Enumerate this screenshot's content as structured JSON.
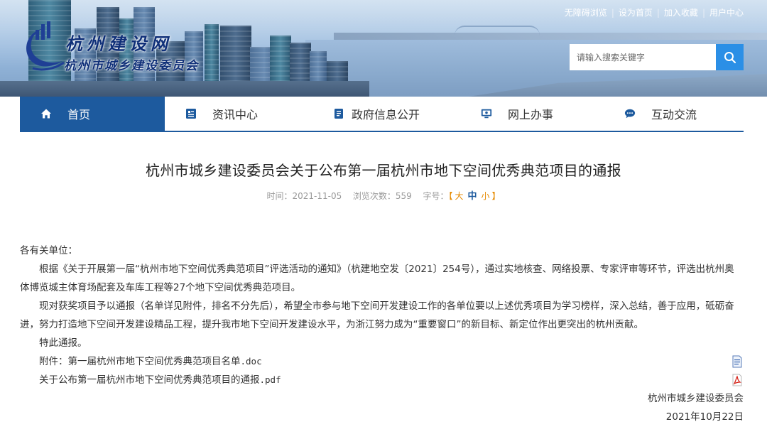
{
  "site": {
    "logo_title": "杭州建设网",
    "logo_subtitle": "杭州市城乡建设委员会"
  },
  "top_links": [
    "无障碍浏览",
    "设为首页",
    "加入收藏",
    "用户中心"
  ],
  "search": {
    "placeholder": "请输入搜索关键字",
    "icon": "search-icon"
  },
  "nav": {
    "items": [
      {
        "label": "首页",
        "icon": "home-icon",
        "active": true
      },
      {
        "label": "资讯中心",
        "icon": "news-icon",
        "active": false
      },
      {
        "label": "政府信息公开",
        "icon": "document-icon",
        "active": false
      },
      {
        "label": "网上办事",
        "icon": "monitor-icon",
        "active": false
      },
      {
        "label": "互动交流",
        "icon": "chat-icon",
        "active": false
      }
    ],
    "active_color": "#1d5a9e"
  },
  "article": {
    "title": "杭州市城乡建设委员会关于公布第一届杭州市地下空间优秀典范项目的通报",
    "meta": {
      "time_label": "时间：",
      "time": "2021-11-05",
      "views_label": "浏览次数：",
      "views": "559",
      "font_label": "字号：",
      "font_open": "【",
      "font_large": "大",
      "font_medium": "中",
      "font_small": "小",
      "font_close": "】"
    },
    "salutation": "各有关单位：",
    "paragraphs": [
      "根据《关于开展第一届“杭州市地下空间优秀典范项目”评选活动的通知》（杭建地空发〔2021〕254号），通过实地核查、网络投票、专家评审等环节，评选出杭州奥体博览城主体育场配套及车库工程等27个地下空间优秀典范项目。",
      "现对获奖项目予以通报（名单详见附件，排名不分先后），希望全市参与地下空间开发建设工作的各单位要以上述优秀项目为学习榜样，深入总结，善于应用，砥砺奋进，努力打造地下空间开发建设精品工程，提升我市地下空间开发建设水平，为浙江努力成为“重要窗口”的新目标、新定位作出更突出的杭州贡献。",
      "特此通报。"
    ],
    "attachments": [
      {
        "prefix": "附件：",
        "name": "第一届杭州市地下空间优秀典范项目名单",
        "ext": ".doc",
        "icon": "word-file-icon"
      },
      {
        "prefix": "",
        "name": "关于公布第一届杭州市地下空间优秀典范项目的通报",
        "ext": ".pdf",
        "icon": "pdf-file-icon"
      }
    ],
    "signature_org": "杭州市城乡建设委员会",
    "signature_date": "2021年10月22日"
  }
}
